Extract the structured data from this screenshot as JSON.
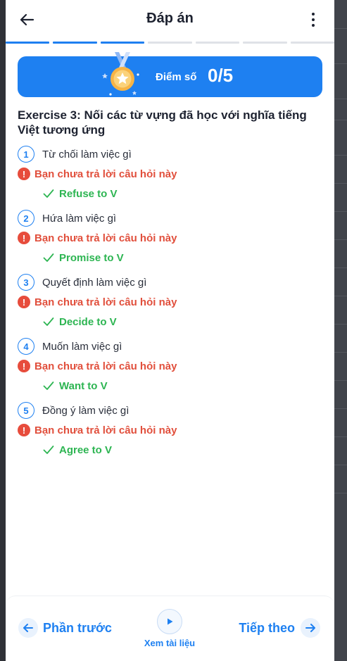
{
  "header": {
    "title": "Đáp án",
    "back_icon": "arrow-left-icon",
    "more_icon": "more-vertical-icon"
  },
  "progress": {
    "total_steps": 7,
    "completed_steps": 3
  },
  "score": {
    "label": "Điểm số",
    "value": "0/5",
    "icon": "medal-icon"
  },
  "exercise": {
    "title": "Exercise 3: Nối các từ vựng đã học với nghĩa tiếng Việt tương ứng",
    "questions": [
      {
        "number": "1",
        "prompt": "Từ chối làm việc gì",
        "status": "Bạn chưa trả lời câu hỏi này",
        "answer": "Refuse to V"
      },
      {
        "number": "2",
        "prompt": "Hứa làm việc gì",
        "status": "Bạn chưa trả lời câu hỏi này",
        "answer": "Promise to V"
      },
      {
        "number": "3",
        "prompt": "Quyết định làm việc gì",
        "status": "Bạn chưa trả lời câu hỏi này",
        "answer": "Decide to V"
      },
      {
        "number": "4",
        "prompt": "Muốn làm việc gì",
        "status": "Bạn chưa trả lời câu hỏi này",
        "answer": "Want to V"
      },
      {
        "number": "5",
        "prompt": "Đồng ý làm việc gì",
        "status": "Bạn chưa trả lời câu hỏi này",
        "answer": "Agree to V"
      }
    ]
  },
  "footer": {
    "prev_label": "Phần trước",
    "next_label": "Tiếp theo",
    "doc_label": "Xem tài liệu"
  },
  "colors": {
    "accent": "#1e80f1",
    "error": "#e14f3c",
    "success": "#2db552",
    "text": "#1d2230"
  }
}
